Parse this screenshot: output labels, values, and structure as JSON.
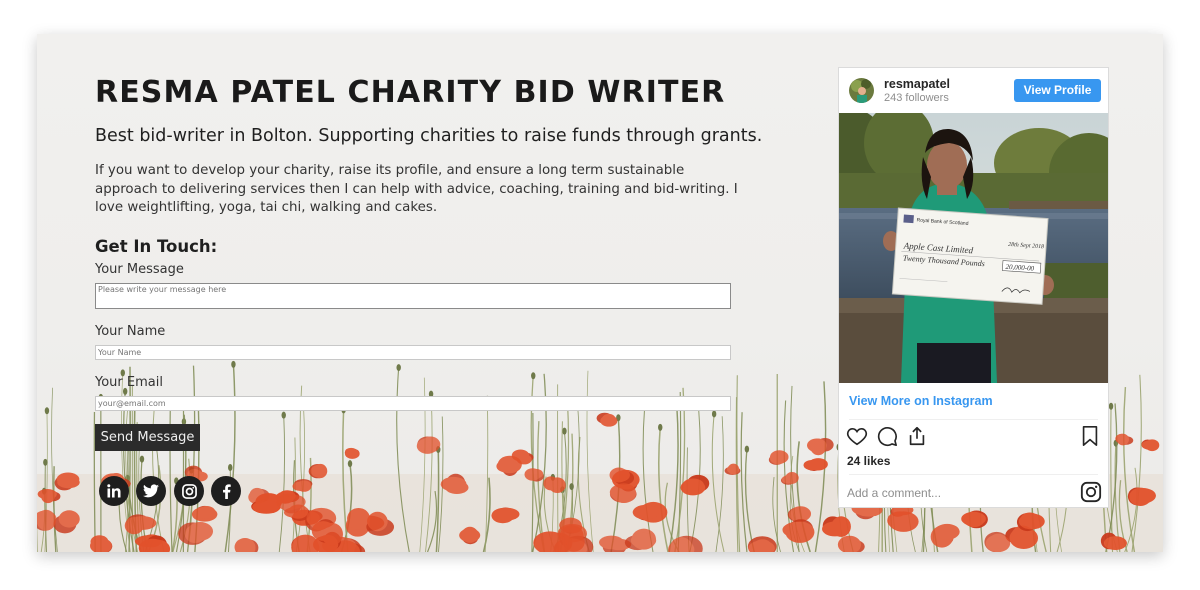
{
  "site": {
    "title": "RESMA PATEL CHARITY BID WRITER",
    "tagline": "Best bid-writer in Bolton. Supporting charities to raise funds through grants.",
    "intro": "If you want to develop your charity, raise its profile, and ensure a long term sustainable approach to delivering services then I can help with advice, coaching, training and bid-writing. I love weightlifting, yoga, tai chi, walking and cakes."
  },
  "contact": {
    "heading": "Get In Touch:",
    "message_label": "Your Message",
    "message_placeholder": "Please write your message here",
    "name_label": "Your Name",
    "name_placeholder": "Your Name",
    "email_label": "Your Email",
    "email_placeholder": "your@email.com",
    "send_label": "Send Message"
  },
  "socials": [
    {
      "icon": "linkedin-icon"
    },
    {
      "icon": "twitter-icon"
    },
    {
      "icon": "instagram-icon"
    },
    {
      "icon": "facebook-icon"
    }
  ],
  "instagram": {
    "username": "resmapatel",
    "followers": "243 followers",
    "view_profile_label": "View Profile",
    "view_more_label": "View More on Instagram",
    "likes": "24 likes",
    "comment_placeholder": "Add a comment...",
    "icons": [
      "heart-icon",
      "comment-icon",
      "share-icon",
      "bookmark-icon",
      "instagram-logo-icon"
    ]
  },
  "cheque": {
    "bank": "Royal Bank of Scotland",
    "date": "28th Sept 2018",
    "payee": "Apple Cast Limited",
    "amount_words": "Twenty Thousand Pounds",
    "amount": "20,000-00"
  },
  "colors": {
    "accent_blue": "#3897f0",
    "title_text": "#1a1a1a",
    "button_dark": "#2b2b2b",
    "poppy": "#e2512b"
  }
}
